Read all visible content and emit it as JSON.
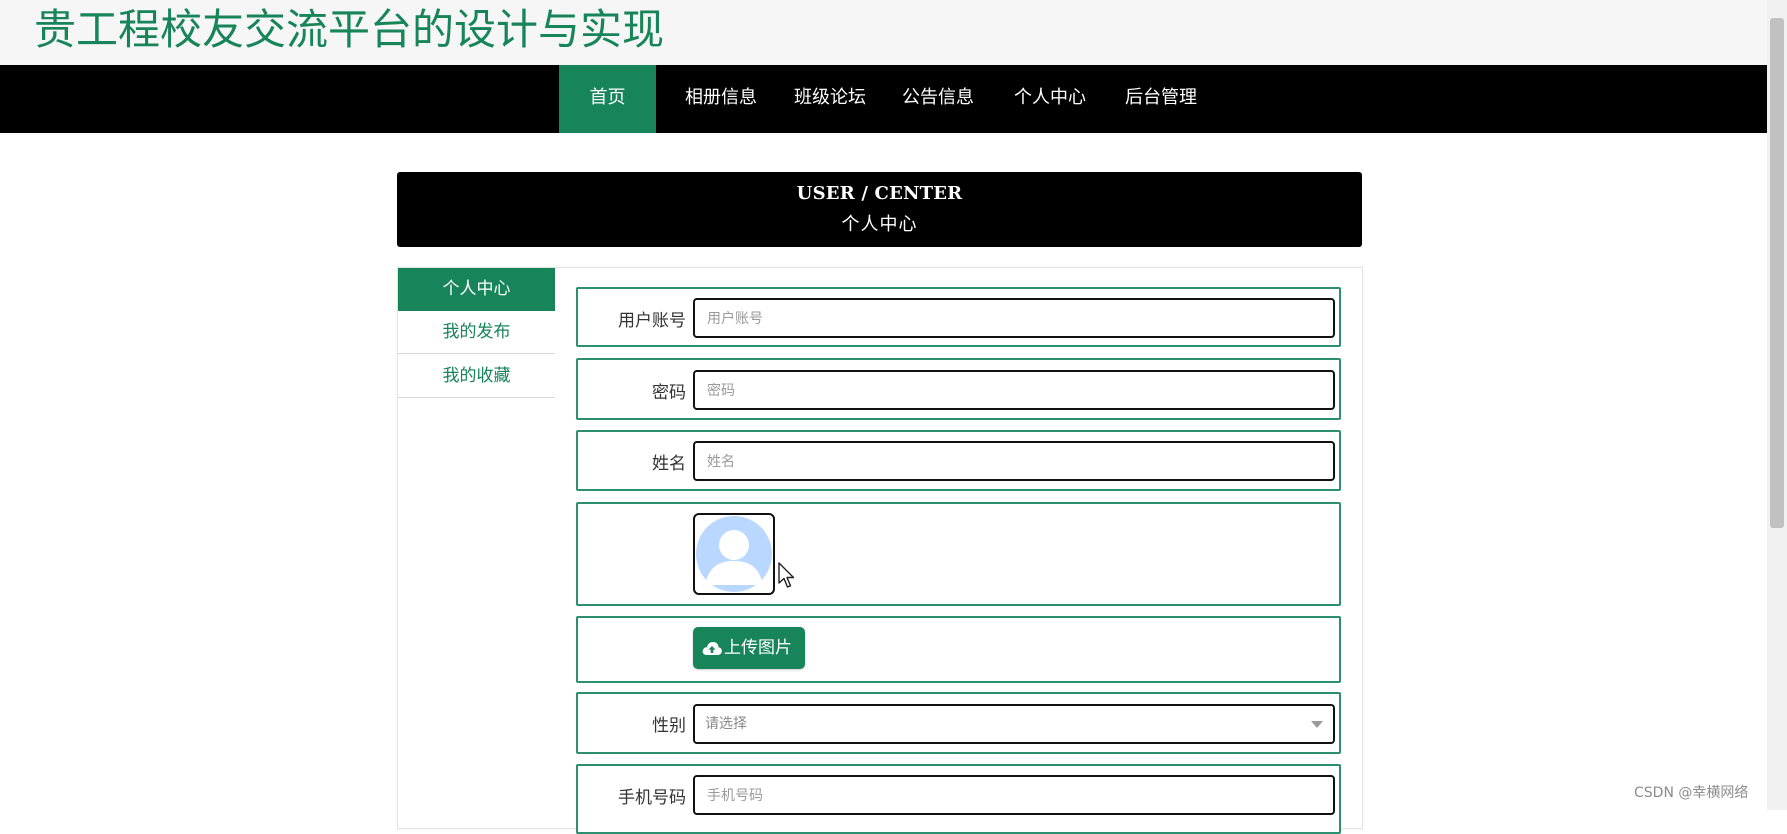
{
  "site": {
    "title": "贵工程校友交流平台的设计与实现"
  },
  "nav": {
    "items": [
      {
        "label": "首页",
        "active": true
      },
      {
        "label": "相册信息",
        "active": false
      },
      {
        "label": "班级论坛",
        "active": false
      },
      {
        "label": "公告信息",
        "active": false
      },
      {
        "label": "个人中心",
        "active": false
      },
      {
        "label": "后台管理",
        "active": false
      }
    ]
  },
  "banner": {
    "en": "USER / CENTER",
    "cn": "个人中心"
  },
  "sidebar": {
    "items": [
      {
        "label": "个人中心",
        "active": true
      },
      {
        "label": "我的发布",
        "active": false
      },
      {
        "label": "我的收藏",
        "active": false
      }
    ]
  },
  "form": {
    "account": {
      "label": "用户账号",
      "placeholder": "用户账号",
      "value": ""
    },
    "password": {
      "label": "密码",
      "placeholder": "密码",
      "value": ""
    },
    "name": {
      "label": "姓名",
      "placeholder": "姓名",
      "value": ""
    },
    "avatar": {
      "icon": "default-user-avatar-icon"
    },
    "upload": {
      "label": "上传图片",
      "icon": "cloud-upload-icon"
    },
    "gender": {
      "label": "性别",
      "placeholder": "请选择"
    },
    "phone": {
      "label": "手机号码",
      "placeholder": "手机号码",
      "value": ""
    }
  },
  "watermark": "CSDN @幸横网络",
  "colors": {
    "brand": "#17845a",
    "row_border": "#2c8f6f",
    "nav_bg": "#000000",
    "avatar_fill": "#b9d7ff"
  }
}
